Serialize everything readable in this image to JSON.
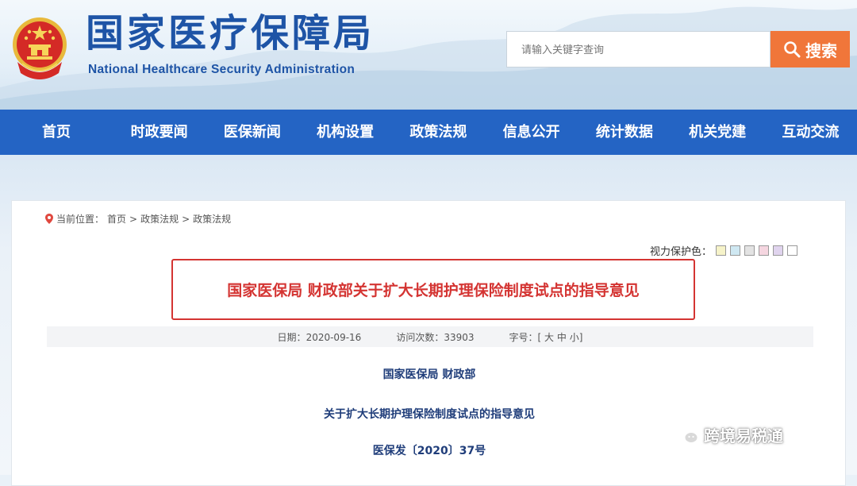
{
  "header": {
    "title": "国家医疗保障局",
    "subtitle": "National Healthcare Security Administration",
    "search_placeholder": "请输入关键字查询",
    "search_button": "搜索"
  },
  "nav": {
    "items": [
      "首页",
      "时政要闻",
      "医保新闻",
      "机构设置",
      "政策法规",
      "信息公开",
      "统计数据",
      "机关党建",
      "互动交流"
    ]
  },
  "breadcrumb": {
    "prefix": "当前位置：",
    "items": [
      "首页",
      "政策法规",
      "政策法规"
    ],
    "separator": ">"
  },
  "vision": {
    "label": "视力保护色：",
    "colors": [
      "#f6f3c9",
      "#cfe8f2",
      "#e3e3e3",
      "#f5d6e0",
      "#e0d4ee",
      "#ffffff"
    ]
  },
  "article": {
    "title": "国家医保局 财政部关于扩大长期护理保险制度试点的指导意见",
    "date_label": "日期：",
    "date": "2020-09-16",
    "visits_label": "访问次数：",
    "visits": "33903",
    "fontsize_label": "字号：",
    "fontsize_open": "[",
    "fontsize_large": "大",
    "fontsize_medium": "中",
    "fontsize_small": "小",
    "fontsize_close": "]",
    "issuer": "国家医保局 财政部",
    "heading": "关于扩大长期护理保险制度试点的指导意见",
    "doc_number": "医保发〔2020〕37号"
  },
  "watermark": {
    "text": "跨境易税通"
  },
  "colors": {
    "brand_blue": "#1e54a6",
    "nav_blue": "#2464c4",
    "search_orange": "#f0763a",
    "highlight_red": "#d43432",
    "body_navy": "#1f3d7a"
  }
}
